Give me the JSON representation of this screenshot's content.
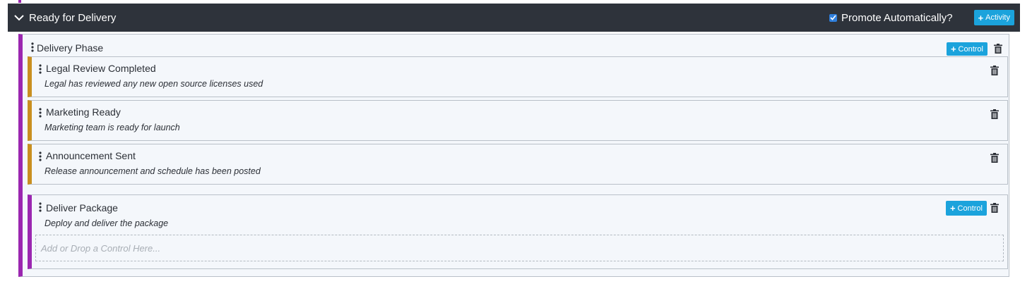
{
  "stage": {
    "title": "Ready for Delivery",
    "promote_label": "Promote Automatically?",
    "promote_checked": true,
    "activity_button": "Activity"
  },
  "phase": {
    "title": "Delivery Phase",
    "control_button": "Control"
  },
  "controls": [
    {
      "title": "Legal Review Completed",
      "description": "Legal has reviewed any new open source licenses used"
    },
    {
      "title": "Marketing Ready",
      "description": "Marketing team is ready for launch"
    },
    {
      "title": "Announcement Sent",
      "description": "Release announcement and schedule has been posted"
    }
  ],
  "group": {
    "title": "Deliver Package",
    "description": "Deploy and deliver the package",
    "control_button": "Control",
    "drop_placeholder": "Add or Drop a Control Here..."
  },
  "colors": {
    "header_bg": "#2e333b",
    "phase_accent": "#9b27b0",
    "control_accent": "#c98f1f",
    "button_blue": "#1ba3dc",
    "checkbox_blue": "#2f7fdc"
  },
  "icons": [
    "chevron-down-icon",
    "checkbox-checked-icon",
    "plus-icon",
    "drag-handle-icon",
    "trash-icon"
  ]
}
